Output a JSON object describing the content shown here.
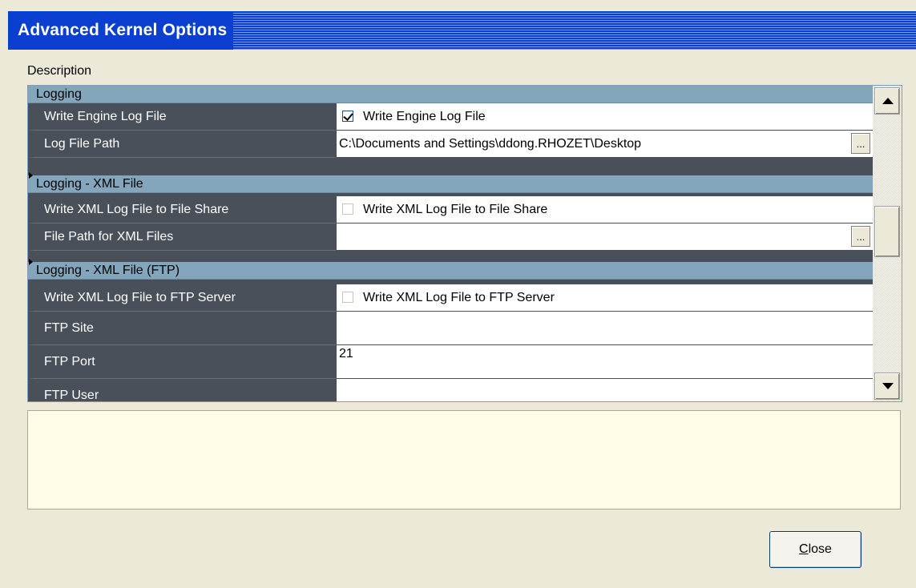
{
  "window": {
    "title": "Advanced Kernel Options"
  },
  "description_label": "Description",
  "grid": {
    "categories": [
      {
        "label": "Logging"
      },
      {
        "label": "Logging - XML File"
      },
      {
        "label": "Logging - XML File (FTP)"
      }
    ],
    "properties": [
      {
        "name": "Write Engine Log File",
        "value": "Write Engine Log File",
        "checked": true
      },
      {
        "name": "Log File Path",
        "value": "C:\\Documents and Settings\\ddong.RHOZET\\Desktop"
      },
      {
        "name": "Write XML Log File to File Share",
        "value": "Write XML Log File to File Share",
        "checked": false
      },
      {
        "name": "File Path for XML Files",
        "value": ""
      },
      {
        "name": "Write XML Log File to FTP Server",
        "value": "Write XML Log File to FTP Server",
        "checked": false
      },
      {
        "name": "FTP Site",
        "value": ""
      },
      {
        "name": "FTP Port",
        "value": "21"
      },
      {
        "name": "FTP User",
        "value": ""
      }
    ],
    "ellipsis_label": "..."
  },
  "close_button": {
    "label_rest": "lose",
    "label_mnemonic": "C"
  },
  "icons": [
    "scroll-up-arrow-icon",
    "scroll-down-arrow-icon",
    "checkbox-icon",
    "expand-marker-icon"
  ]
}
